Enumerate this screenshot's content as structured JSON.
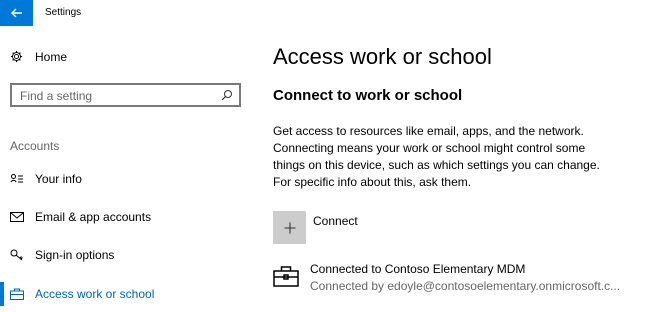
{
  "window": {
    "title": "Settings"
  },
  "sidebar": {
    "home_label": "Home",
    "search": {
      "placeholder": "Find a setting"
    },
    "section_header": "Accounts",
    "items": [
      {
        "label": "Your info",
        "icon": "person-card-icon",
        "active": false
      },
      {
        "label": "Email & app accounts",
        "icon": "mail-icon",
        "active": false
      },
      {
        "label": "Sign-in options",
        "icon": "key-icon",
        "active": false
      },
      {
        "label": "Access work or school",
        "icon": "briefcase-icon",
        "active": true
      }
    ]
  },
  "main": {
    "title": "Access work or school",
    "subtitle": "Connect to work or school",
    "description": "Get access to resources like email, apps, and the network. Connecting means your work or school might control some things on this device, such as which settings you can change. For specific info about this, ask them.",
    "connect_label": "Connect",
    "account": {
      "name": "Connected to Contoso Elementary MDM",
      "detail": "Connected by edoyle@contosoelementary.onmicrosoft.c..."
    }
  },
  "colors": {
    "accent": "#0078d7",
    "active_text": "#0063b1",
    "tile": "#cccccc"
  }
}
